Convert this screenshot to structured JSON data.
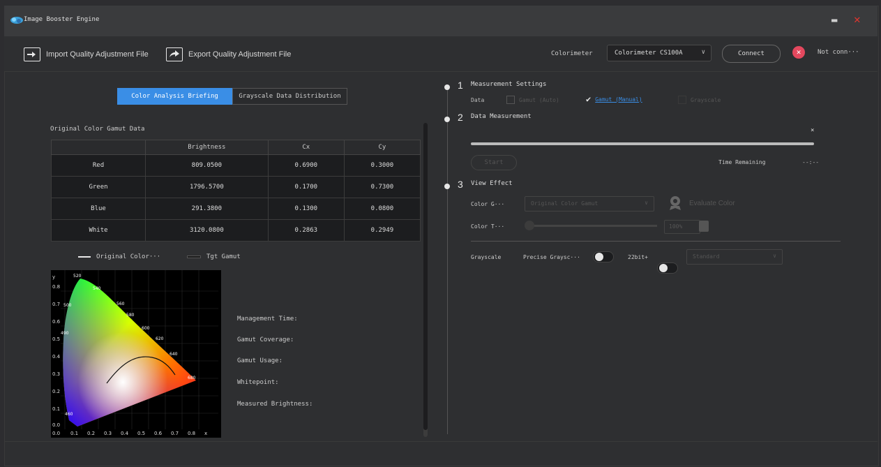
{
  "window": {
    "title": "Image Booster Engine"
  },
  "toolbar": {
    "import_label": "Import Quality Adjustment File",
    "export_label": "Export Quality Adjustment File",
    "colorimeter_label": "Colorimeter",
    "colorimeter_value": "Colorimeter CS100A",
    "connect_label": "Connect",
    "status_text": "Not conn···"
  },
  "tabs": [
    "Color Analysis Briefing",
    "Grayscale Data Distribution"
  ],
  "gamut": {
    "title": "Original Color Gamut Data",
    "headers": [
      "",
      "Brightness",
      "Cx",
      "Cy"
    ],
    "rows": [
      [
        "Red",
        "809.0500",
        "0.6900",
        "0.3000"
      ],
      [
        "Green",
        "1796.5700",
        "0.1700",
        "0.7300"
      ],
      [
        "Blue",
        "291.3800",
        "0.1300",
        "0.0800"
      ],
      [
        "White",
        "3120.0800",
        "0.2863",
        "0.2949"
      ]
    ]
  },
  "legend": {
    "original": "Original Color···",
    "target": "Tgt Gamut"
  },
  "cie": {
    "x_ticks": [
      "0.0",
      "0.1",
      "0.2",
      "0.3",
      "0.4",
      "0.5",
      "0.6",
      "0.7",
      "0.8",
      "x"
    ],
    "y_ticks": [
      "y",
      "0.8",
      "0.7",
      "0.6",
      "0.5",
      "0.4",
      "0.3",
      "0.2",
      "0.1",
      "0.0"
    ]
  },
  "metrics": [
    "Management Time:",
    "Gamut Coverage:",
    "Gamut Usage:",
    "Whitepoint:",
    "Measured Brightness:"
  ],
  "step1": {
    "num": "1",
    "title": "Measurement Settings",
    "data_label": "Data",
    "opt_auto": "Gamut (Auto)",
    "opt_manual": "Gamut (Manual)",
    "opt_gray": "Grayscale"
  },
  "step2": {
    "num": "2",
    "title": "Data Measurement",
    "start": "Start",
    "time_label": "Time Remaining",
    "time_value": "--:--"
  },
  "step3": {
    "num": "3",
    "title": "View Effect",
    "color_g_label": "Color G···",
    "color_g_value": "Original Color Gamut",
    "evaluate": "Evaluate Color",
    "color_t_label": "Color T···",
    "color_t_value": "100%"
  },
  "grayscale": {
    "label": "Grayscale",
    "precise": "Precise Graysc···",
    "bit": "22bit+",
    "select": "Standard"
  }
}
